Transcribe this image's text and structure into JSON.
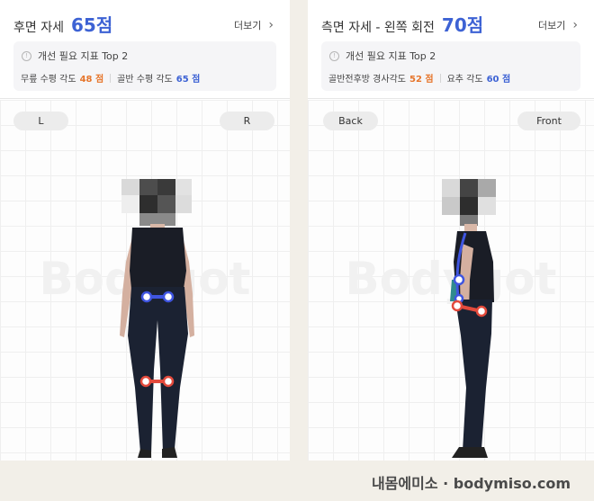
{
  "back_panel": {
    "title": "후면 자세",
    "score": "65점",
    "more_label": "더보기",
    "info_icon_glyph": "!",
    "info_text": "개선 필요 지표 Top 2",
    "metrics": [
      {
        "label": "무릎 수평 각도",
        "value": "48 점",
        "color": "#e6752b"
      },
      {
        "label": "골반 수평 각도",
        "value": "65 점",
        "color": "#3d62d4"
      }
    ],
    "left_button": "L",
    "right_button": "R",
    "watermark": "Bodygot"
  },
  "side_panel": {
    "title": "측면 자세 - 왼쪽 회전",
    "score": "70점",
    "more_label": "더보기",
    "info_icon_glyph": "!",
    "info_text": "개선 필요 지표 Top 2",
    "metrics": [
      {
        "label": "골반전후방 경사각도",
        "value": "52 점",
        "color": "#e6752b"
      },
      {
        "label": "요추 각도",
        "value": "60 점",
        "color": "#3d62d4"
      }
    ],
    "left_button": "Back",
    "right_button": "Front",
    "watermark": "Bodygot"
  },
  "footer": {
    "credit": "내몸에미소 · bodymiso.com"
  },
  "colors": {
    "accent_blue": "#3d62d4",
    "accent_orange": "#e6752b",
    "marker_blue": "#3f55e0",
    "marker_red": "#e34a3c"
  },
  "icons": [
    "info-icon",
    "chevron-right-icon"
  ]
}
